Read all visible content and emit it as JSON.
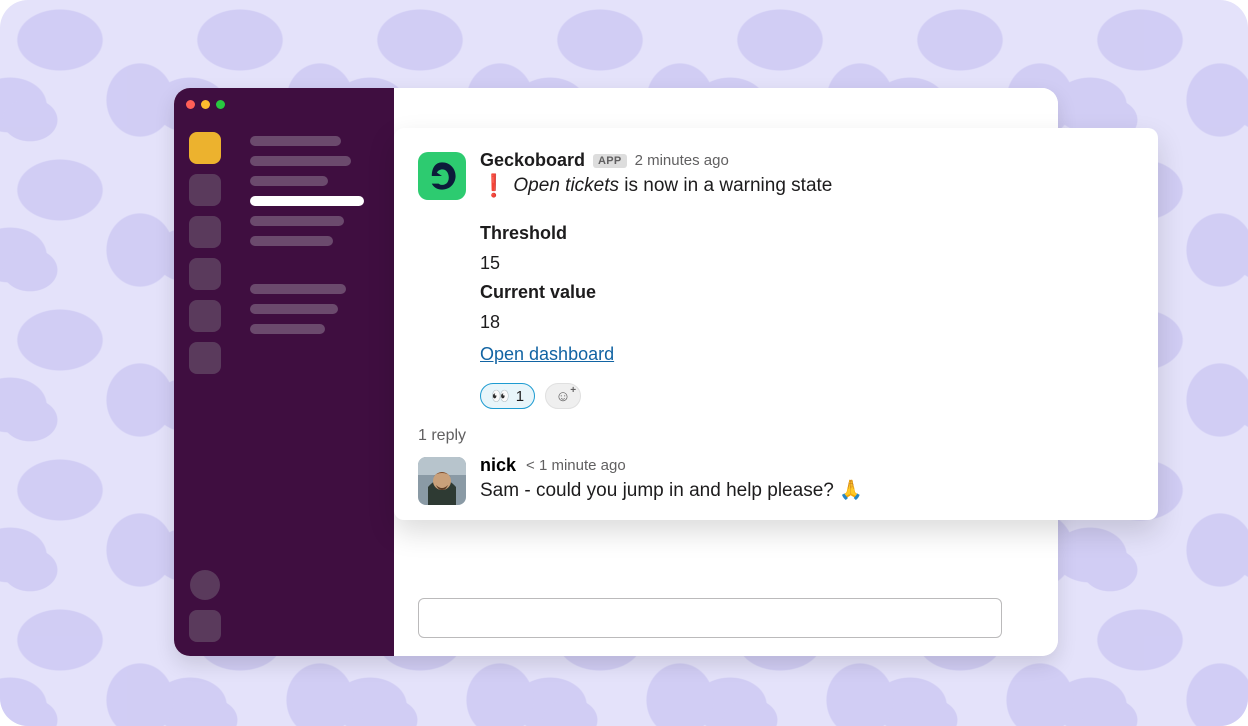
{
  "message": {
    "author": "Geckoboard",
    "app_badge": "APP",
    "timestamp": "2 minutes ago",
    "alert_emoji": "❗",
    "metric_name": "Open tickets",
    "alert_rest": "is now in a warning state",
    "threshold_label": "Threshold",
    "threshold_value": "15",
    "current_label": "Current value",
    "current_value": "18",
    "dashboard_link": "Open dashboard"
  },
  "reactions": {
    "eyes_emoji": "👀",
    "eyes_count": "1",
    "add_face": "☺"
  },
  "thread": {
    "reply_count_label": "1 reply",
    "reply": {
      "author": "nick",
      "timestamp": "< 1 minute ago",
      "body": "Sam - could you jump in and help please? 🙏"
    }
  }
}
